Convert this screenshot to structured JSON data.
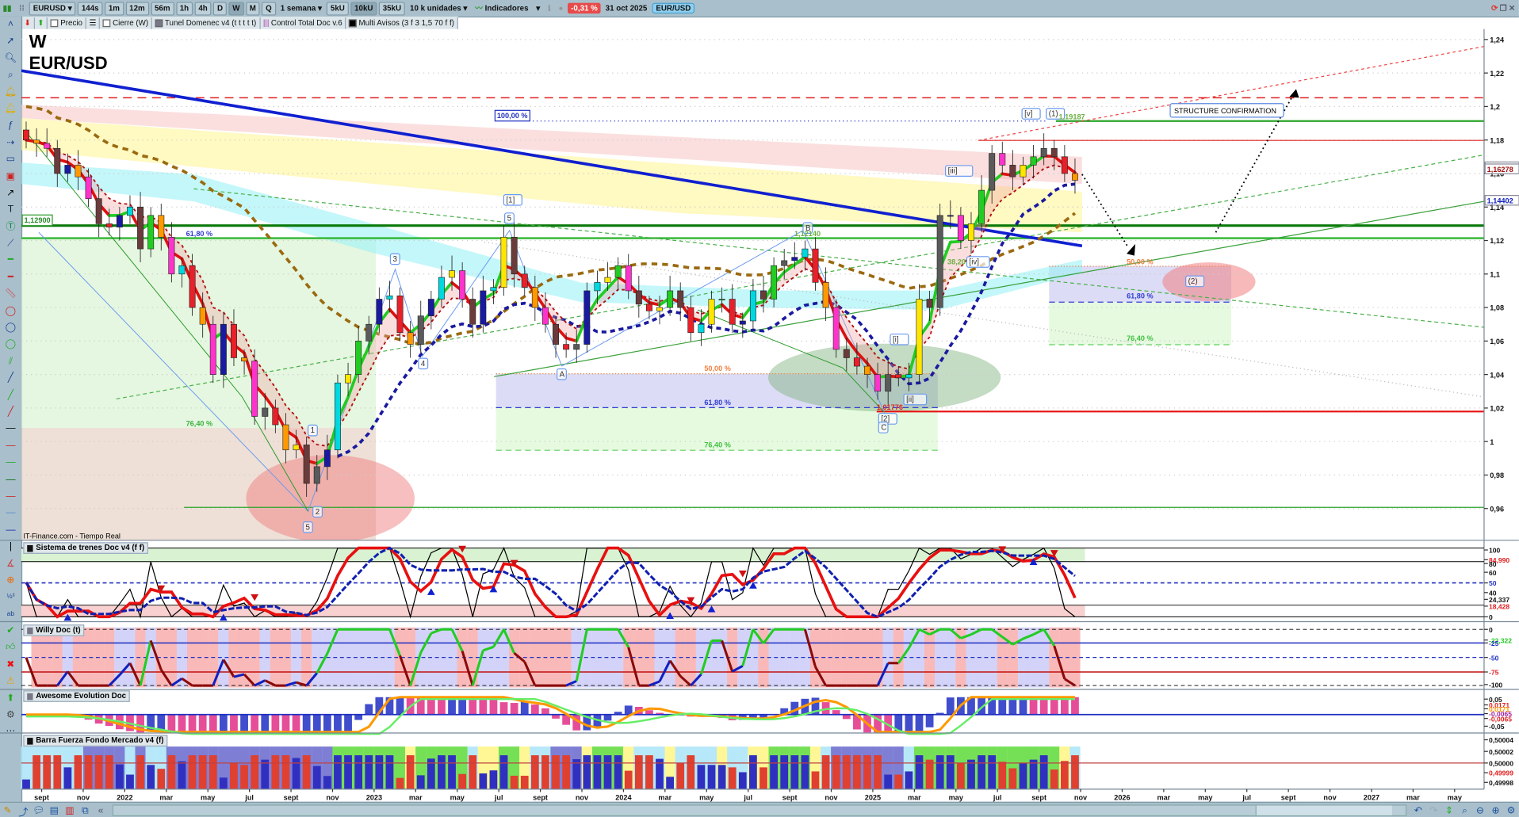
{
  "toolbar": {
    "symbol": "EURUSD",
    "timeframes": [
      "144s",
      "1m",
      "12m",
      "56m",
      "1h",
      "4h",
      "D",
      "W",
      "M",
      "Q"
    ],
    "active_timeframe": "W",
    "period": "1 semana",
    "units": [
      "5kU",
      "10kU",
      "35kU"
    ],
    "active_unit": "10kU",
    "unit_select": "10 k unidades",
    "indicators": "Indicadores",
    "change": "-0,31 %",
    "date": "31 oct 2025",
    "pair": "EUR/USD"
  },
  "legend": {
    "price": "Precio",
    "close": "Cierre (W)",
    "tunnel": "Tunel Domenec v4 (t t t t t)",
    "control": "Control Total Doc v.6",
    "alerts": "Multi Avisos (3 f 3 1,5 70 f f)"
  },
  "chart_title": {
    "timeframe": "W",
    "pair": "EUR/USD"
  },
  "source": "IT-Finance.com - Tiempo Real",
  "annotations": {
    "fib100": "100,00 %",
    "level_left": "1,12900",
    "fib_left_618": "61,80 %",
    "fib_left_764": "76,40 %",
    "w1": "1",
    "w2": "2",
    "w3": "3",
    "w4": "4",
    "w5a": "5",
    "w5b": "5",
    "wave1_big": "[1]",
    "A": "A",
    "B": "B",
    "C": "C",
    "level_b": "1,12140",
    "fib_mid_50": "50,00 %",
    "fib_mid_618": "61,80 %",
    "fib_mid_764": "76,40 %",
    "i": "[i]",
    "ii": "[ii]",
    "two": "[2]",
    "low": "1,01776",
    "iii": "[iii]",
    "iv": "[iv]",
    "fib382": "38,20",
    "v": "[v]",
    "one_paren": "(1)",
    "high": "1,19187",
    "structure": "STRUCTURE CONFIRMATION",
    "fib_r_50": "50,00 %",
    "fib_r_618": "61,80 %",
    "fib_r_764": "76,40 %",
    "two_paren": "(2)"
  },
  "colors": {
    "up": "#00d8e0",
    "down": "#e8202a",
    "trend_blue": "#1020d0",
    "support_green": "#2aa52a",
    "resistance_red": "#e02020"
  },
  "chart_data": {
    "type": "candlestick",
    "title": "EUR/USD W",
    "interval": "semi-monthly approximation of weekly candles",
    "start": "2021-08",
    "closes": [
      1.18,
      1.178,
      1.175,
      1.16,
      1.165,
      1.158,
      1.145,
      1.13,
      1.128,
      1.135,
      1.14,
      1.115,
      1.135,
      1.122,
      1.1,
      1.105,
      1.08,
      1.07,
      1.04,
      1.07,
      1.05,
      1.048,
      1.015,
      1.02,
      1.01,
      0.995,
      0.998,
      0.975,
      0.985,
      0.995,
      1.035,
      1.04,
      1.06,
      1.07,
      1.085,
      1.087,
      1.065,
      1.058,
      1.075,
      1.085,
      1.098,
      1.102,
      1.085,
      1.07,
      1.09,
      1.092,
      1.122,
      1.1,
      1.092,
      1.08,
      1.07,
      1.058,
      1.055,
      1.058,
      1.09,
      1.095,
      1.098,
      1.105,
      1.09,
      1.082,
      1.078,
      1.08,
      1.09,
      1.08,
      1.065,
      1.07,
      1.085,
      1.085,
      1.07,
      1.072,
      1.09,
      1.085,
      1.105,
      1.108,
      1.11,
      1.115,
      1.095,
      1.08,
      1.055,
      1.05,
      1.045,
      1.04,
      1.03,
      1.04,
      1.038,
      1.04,
      1.085,
      1.08,
      1.135,
      1.135,
      1.12,
      1.13,
      1.15,
      1.172,
      1.165,
      1.158,
      1.165,
      1.17,
      1.175,
      1.17,
      1.16,
      1.156
    ],
    "ylim": [
      0.95,
      1.25
    ],
    "y_ticks": [
      "1,24",
      "1,22",
      "1,2",
      "1,18",
      "1,16",
      "1,14",
      "1,12",
      "1,1",
      "1,08",
      "1,06",
      "1,04",
      "1,02",
      "1",
      "0,98",
      "0,96"
    ],
    "y_tick_values": [
      1.24,
      1.22,
      1.2,
      1.18,
      1.16,
      1.14,
      1.12,
      1.1,
      1.08,
      1.06,
      1.04,
      1.02,
      1.0,
      0.98,
      0.96
    ],
    "price_labels": [
      {
        "text": "1,16399",
        "value": 1.16399,
        "color": "#e02020"
      },
      {
        "text": "1,16278",
        "value": 1.16278,
        "color": "#a01010"
      },
      {
        "text": "1,14402",
        "value": 1.14402,
        "color": "#1020c0"
      }
    ],
    "x_ticks": [
      "sept",
      "nov",
      "2022",
      "mar",
      "may",
      "jul",
      "sept",
      "nov",
      "2023",
      "mar",
      "may",
      "jul",
      "sept",
      "nov",
      "2024",
      "mar",
      "may",
      "jul",
      "sept",
      "nov",
      "2025",
      "mar",
      "may",
      "jul",
      "sept",
      "nov",
      "2026",
      "mar",
      "may",
      "jul",
      "sept",
      "nov",
      "2027",
      "mar",
      "may"
    ],
    "horizontal_levels": [
      1.205,
      1.19187,
      1.18,
      1.129,
      1.1214,
      1.01776,
      0.96
    ]
  },
  "panels": [
    {
      "title": "Sistema de trenes Doc v4 (f f)",
      "axis": [
        "100",
        "84,990",
        "80",
        "60",
        "50",
        "40",
        "24,337",
        "18,428",
        "0"
      ]
    },
    {
      "title": "Willy Doc (t)",
      "axis": [
        "0",
        "-22,322",
        "-25",
        "-50",
        "-75",
        "-100"
      ]
    },
    {
      "title": "Awesome Evolution Doc",
      "axis": [
        "0,05",
        "0,0171",
        "0,0171",
        "-0,0065",
        "-0,0065",
        "-0,05"
      ]
    },
    {
      "title": "Barra Fuerza Fondo Mercado v4 (f)",
      "axis": [
        "0,50004",
        "0,50002",
        "0,50000",
        "0,49999",
        "0,49998"
      ]
    }
  ]
}
